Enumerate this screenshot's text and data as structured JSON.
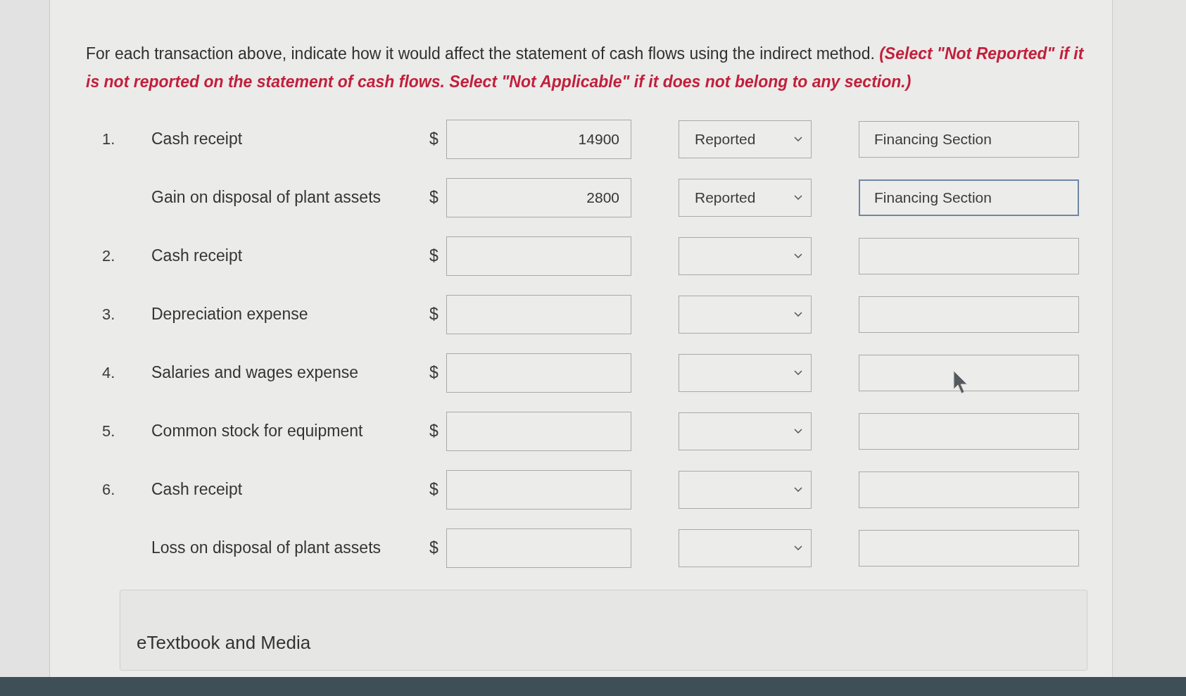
{
  "instructions": "For each transaction above, indicate how it would affect the statement of cash flows using the indirect method. **(Select \"Not Reported\" if it is not reported on the statement of cash flows. Select \"Not Applicable\" if it does not belong to any section.)**",
  "rows": [
    {
      "number": "1.",
      "label": "Cash receipt",
      "currency": "$",
      "amount": "14900",
      "reporting": "Reported",
      "section": "Financing Section",
      "section_focused": false
    },
    {
      "label": "Gain on disposal of plant assets",
      "currency": "$",
      "amount": "2800",
      "reporting": "Reported",
      "section": "Financing Section",
      "section_focused": true
    },
    {
      "number": "2.",
      "label": "Cash receipt",
      "currency": "$",
      "section_focused": false
    },
    {
      "number": "3.",
      "label": "Depreciation expense",
      "currency": "$",
      "section_focused": false
    },
    {
      "number": "4.",
      "label": "Salaries and wages expense",
      "currency": "$",
      "section_focused": false
    },
    {
      "number": "5.",
      "label": "Common stock for equipment",
      "currency": "$",
      "section_focused": false
    },
    {
      "number": "6.",
      "label": "Cash receipt",
      "currency": "$",
      "section_focused": false
    },
    {
      "label": "Loss on disposal of plant assets",
      "currency": "$",
      "section_focused": false
    }
  ],
  "etextbook": {
    "label": "eTextbook and Media"
  }
}
